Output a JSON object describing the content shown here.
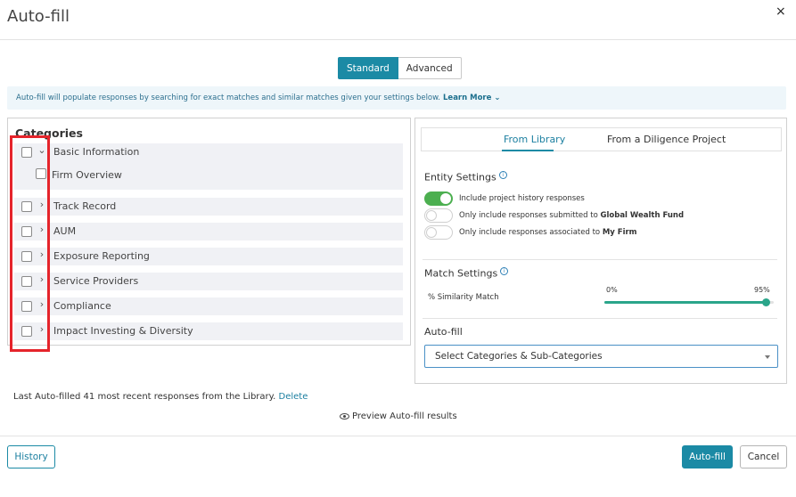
{
  "dialog": {
    "title": "Auto-fill",
    "close_icon": "×"
  },
  "mode": {
    "standard_label": "Standard",
    "advanced_label": "Advanced"
  },
  "info": {
    "text": "Auto-fill will populate responses by searching for exact matches and similar matches given your settings below.",
    "learn_more": "Learn More"
  },
  "categories": {
    "title": "Categories",
    "items": [
      {
        "label": "Basic Information",
        "expanded": true,
        "sub": [
          {
            "label": "Firm Overview"
          }
        ]
      },
      {
        "label": "Track Record",
        "expanded": false
      },
      {
        "label": "AUM",
        "expanded": false
      },
      {
        "label": "Exposure Reporting",
        "expanded": false
      },
      {
        "label": "Service Providers",
        "expanded": false
      },
      {
        "label": "Compliance",
        "expanded": false
      },
      {
        "label": "Impact Investing & Diversity",
        "expanded": false
      }
    ]
  },
  "settings": {
    "tabs": [
      {
        "label": "From Library"
      },
      {
        "label": "From a Diligence Project"
      }
    ],
    "entity_title": "Entity Settings",
    "toggles": [
      {
        "text": "Include project history responses",
        "bold": "",
        "on": true
      },
      {
        "text": "Only include responses submitted to",
        "bold": "Global Wealth Fund",
        "on": false
      },
      {
        "text": "Only include responses associated to",
        "bold": "My Firm",
        "on": false
      }
    ],
    "match_title": "Match Settings",
    "similarity_label": "% Similarity Match",
    "slider_min": "0%",
    "slider_max": "95%",
    "slider_value": 95,
    "autofill_title": "Auto-fill",
    "select_value": "Select Categories & Sub-Categories"
  },
  "footer": {
    "last_autofill": "Last Auto-filled 41 most recent responses from the Library.",
    "delete_label": "Delete",
    "preview_label": "Preview Auto-fill results",
    "history_label": "History",
    "autofill_label": "Auto-fill",
    "cancel_label": "Cancel"
  },
  "colors": {
    "accent": "#1b8aa5",
    "toggle_on": "#4caf50",
    "slider": "#2aa58a",
    "highlight": "#e5242b"
  }
}
